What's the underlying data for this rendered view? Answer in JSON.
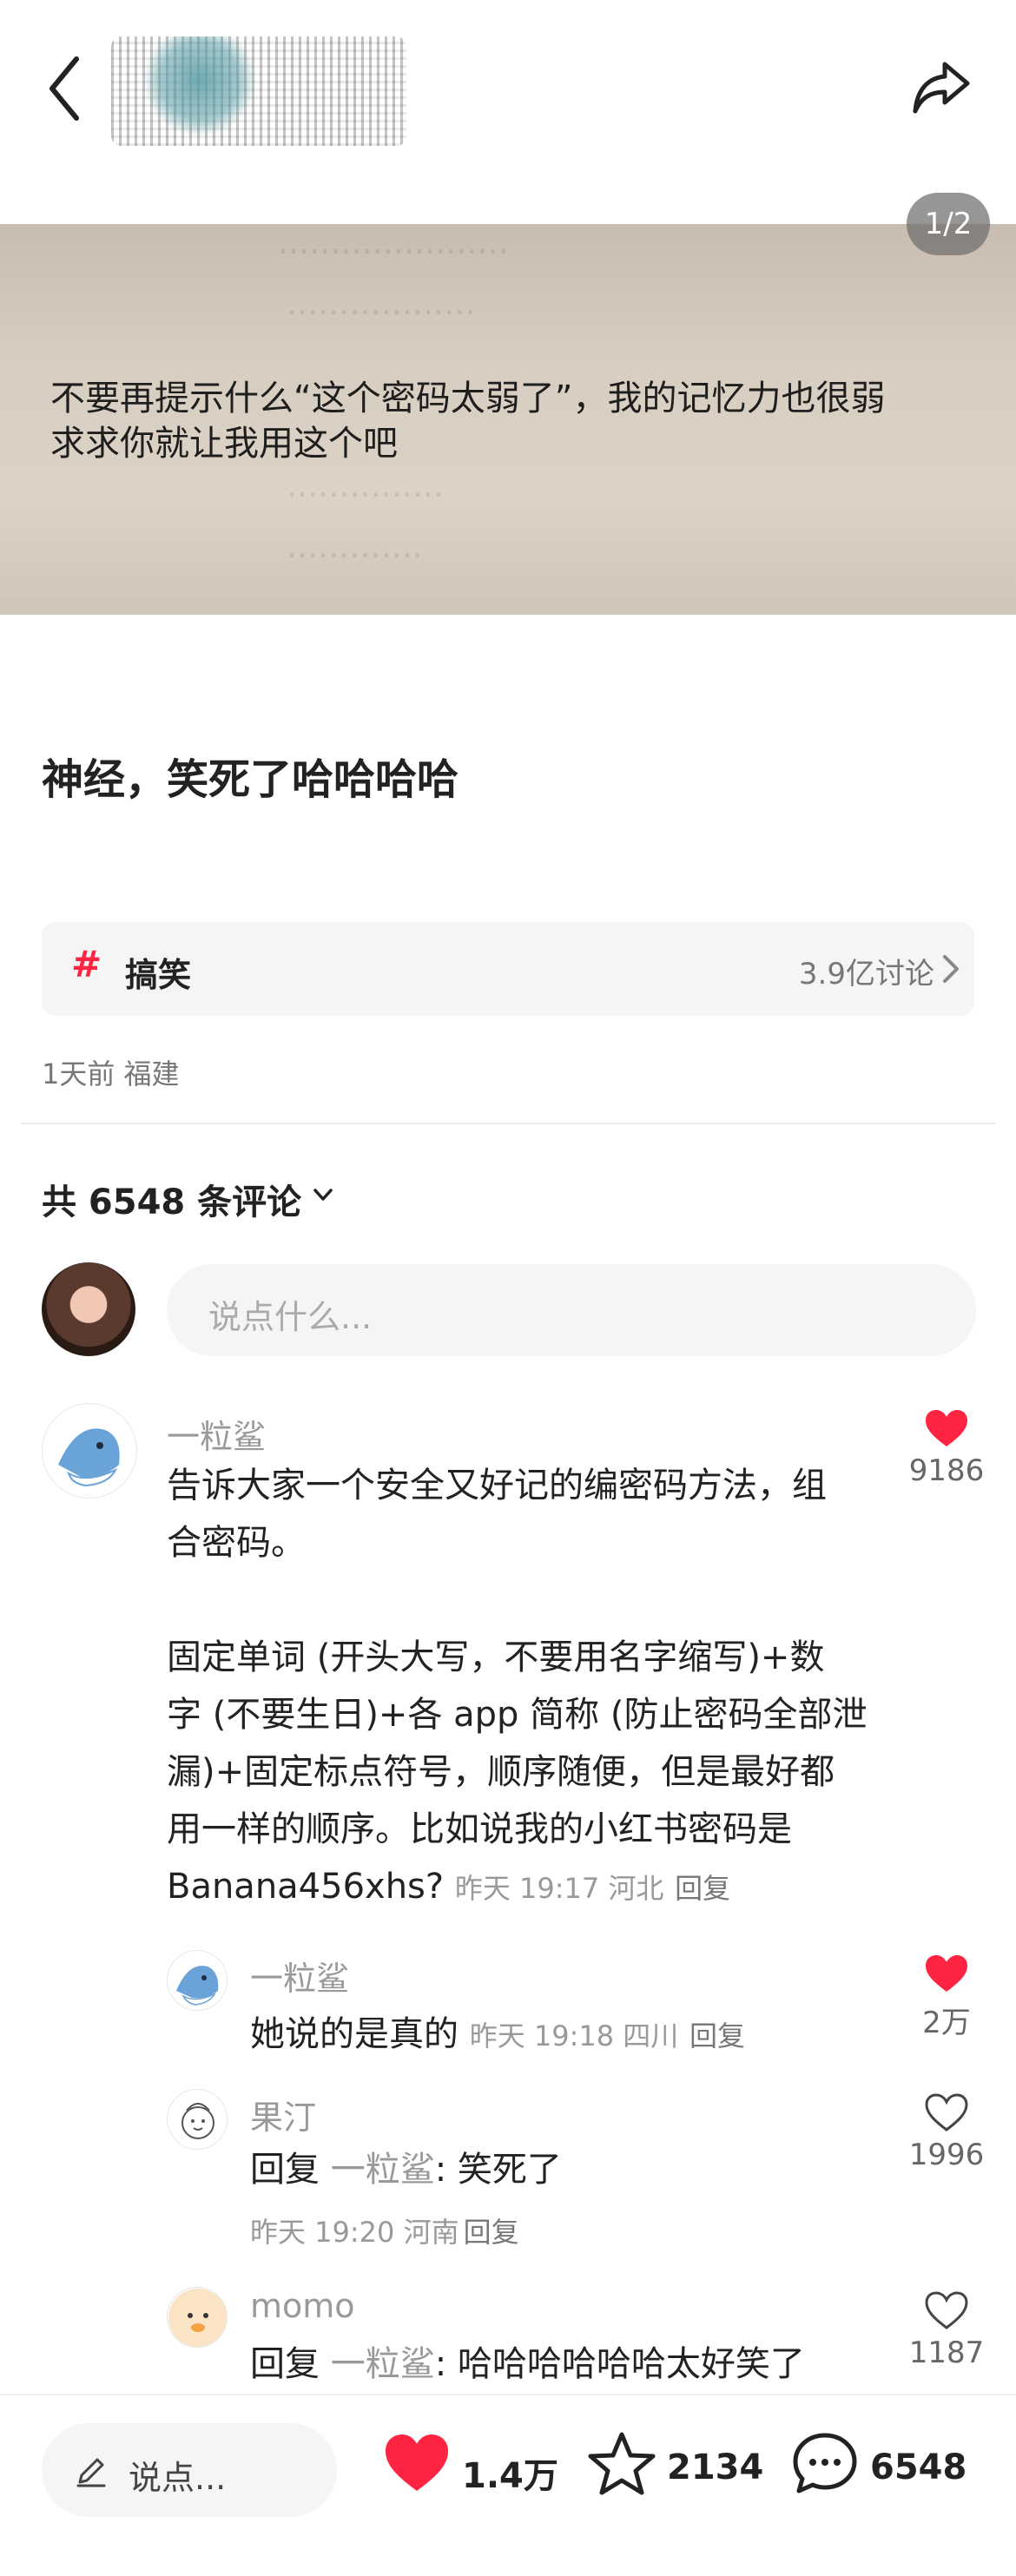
{
  "header": {
    "author_name": "",
    "icons": {
      "back": "chevron-left-icon",
      "share": "share-arrow-icon"
    }
  },
  "photo": {
    "caption_line1": "不要再提示什么“这个密码太弱了”，我的记忆力也很弱",
    "caption_line2": "求求你就让我用这个吧",
    "page_counter": "1/2"
  },
  "post": {
    "title": "神经，笑死了哈哈哈哈",
    "topic": {
      "name": "搞笑",
      "count": "3.9亿讨论"
    },
    "meta": "1天前 福建"
  },
  "comments_section": {
    "total_label": "共 6548 条评论",
    "input_placeholder": "说点什么..."
  },
  "comments": [
    {
      "name": "一粒鲨",
      "text_p1_l1": "告诉大家一个安全又好记的编密码方法，组",
      "text_p1_l2": "合密码。",
      "text_p2_l1": "固定单词 (开头大写，不要用名字缩写)+数",
      "text_p2_l2": "字 (不要生日)+各 app 简称 (防止密码全部泄",
      "text_p2_l3": "漏)+固定标点符号，顺序随便，但是最好都",
      "text_p2_l4": "用一样的顺序。比如说我的小红书密码是",
      "text_p2_l5": "Banana456xhs?",
      "meta": "昨天 19:17 河北",
      "reply": "回复",
      "likes": "9186",
      "liked": true
    }
  ],
  "replies": [
    {
      "name": "一粒鲨",
      "text": "她说的是真的",
      "meta": "昨天 19:18 四川",
      "reply": "回复",
      "likes": "2万",
      "liked": true
    },
    {
      "name": "果汀",
      "prefix": "回复",
      "quote": "一粒鲨",
      "text": ": 笑死了",
      "meta": "昨天 19:20 河南",
      "reply": "回复",
      "likes": "1996",
      "liked": false
    },
    {
      "name": "momo",
      "prefix": "回复",
      "quote": "一粒鲨",
      "text": ": 哈哈哈哈哈哈太好笑了",
      "likes": "1187",
      "liked": false
    }
  ],
  "bottom_bar": {
    "input_placeholder": "说点...",
    "likes": "1.4万",
    "favorites": "2134",
    "comments": "6548"
  },
  "colors": {
    "accent": "#ff2442",
    "muted": "#999999",
    "surface": "#f5f5f5"
  }
}
